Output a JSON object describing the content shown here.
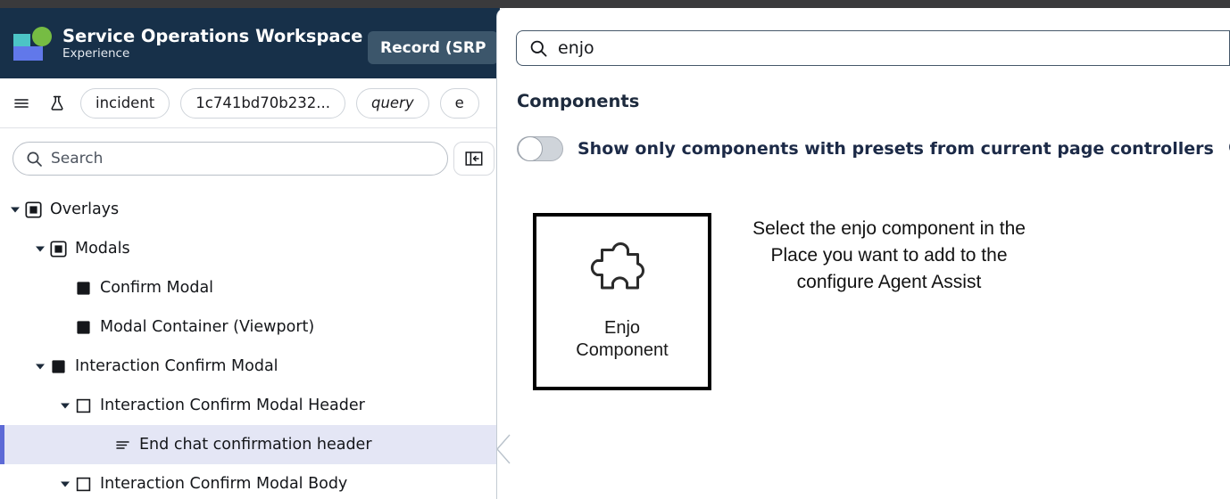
{
  "window": {
    "top_strip_color": "#3a3a3c"
  },
  "brand": {
    "title": "Service Operations Workspace",
    "subtitle": "Experience",
    "record_button": "Record (SRP",
    "header_bg": "#173049",
    "record_bg": "#3c566b"
  },
  "toolbar": {
    "menu_icon": "hamburger-menu-icon",
    "lab_icon": "flask-icon",
    "chips": [
      {
        "label": "incident",
        "italic": false
      },
      {
        "label": "1c741bd70b232...",
        "italic": false
      },
      {
        "label": "query",
        "italic": true
      },
      {
        "label": "e",
        "italic": false
      }
    ]
  },
  "sidebar": {
    "search_placeholder": "Search",
    "search_icon": "search-icon",
    "collapse_icon": "collapse-panel-icon",
    "tree": [
      {
        "label": "Overlays",
        "depth": 0,
        "twisty": "down",
        "icon": "container-node-icon",
        "selected": false
      },
      {
        "label": "Modals",
        "depth": 1,
        "twisty": "down",
        "icon": "container-node-icon",
        "selected": false
      },
      {
        "label": "Confirm Modal",
        "depth": 2,
        "twisty": "none",
        "icon": "filled-square-icon",
        "selected": false
      },
      {
        "label": "Modal Container (Viewport)",
        "depth": 2,
        "twisty": "none",
        "icon": "filled-square-icon",
        "selected": false
      },
      {
        "label": "Interaction Confirm Modal",
        "depth": 2,
        "twisty": "down",
        "icon": "filled-square-icon",
        "selected": false
      },
      {
        "label": "Interaction Confirm Modal Header",
        "depth": 3,
        "twisty": "down",
        "icon": "outline-square-icon",
        "selected": false
      },
      {
        "label": "End chat confirmation header",
        "depth": 4,
        "twisty": "none",
        "icon": "text-lines-icon",
        "selected": true
      },
      {
        "label": "Interaction Confirm Modal Body",
        "depth": 3,
        "twisty": "down",
        "icon": "outline-square-icon",
        "selected": false
      }
    ],
    "selected_row_bg": "#e4e6f5",
    "selected_row_accent": "#5d6ad6"
  },
  "overlay_panel": {
    "search_value": "enjo",
    "search_icon": "search-icon",
    "section_title": "Components",
    "toggle": {
      "label": "Show only components with presets from current page controllers",
      "state": "off",
      "info_icon": "info-circle-icon"
    },
    "component_card": {
      "icon": "puzzle-piece-icon",
      "label_line1": "Enjo",
      "label_line2": "Component"
    },
    "helper_text": "Select the enjo component in the Place you want to add to the configure Agent Assist"
  }
}
